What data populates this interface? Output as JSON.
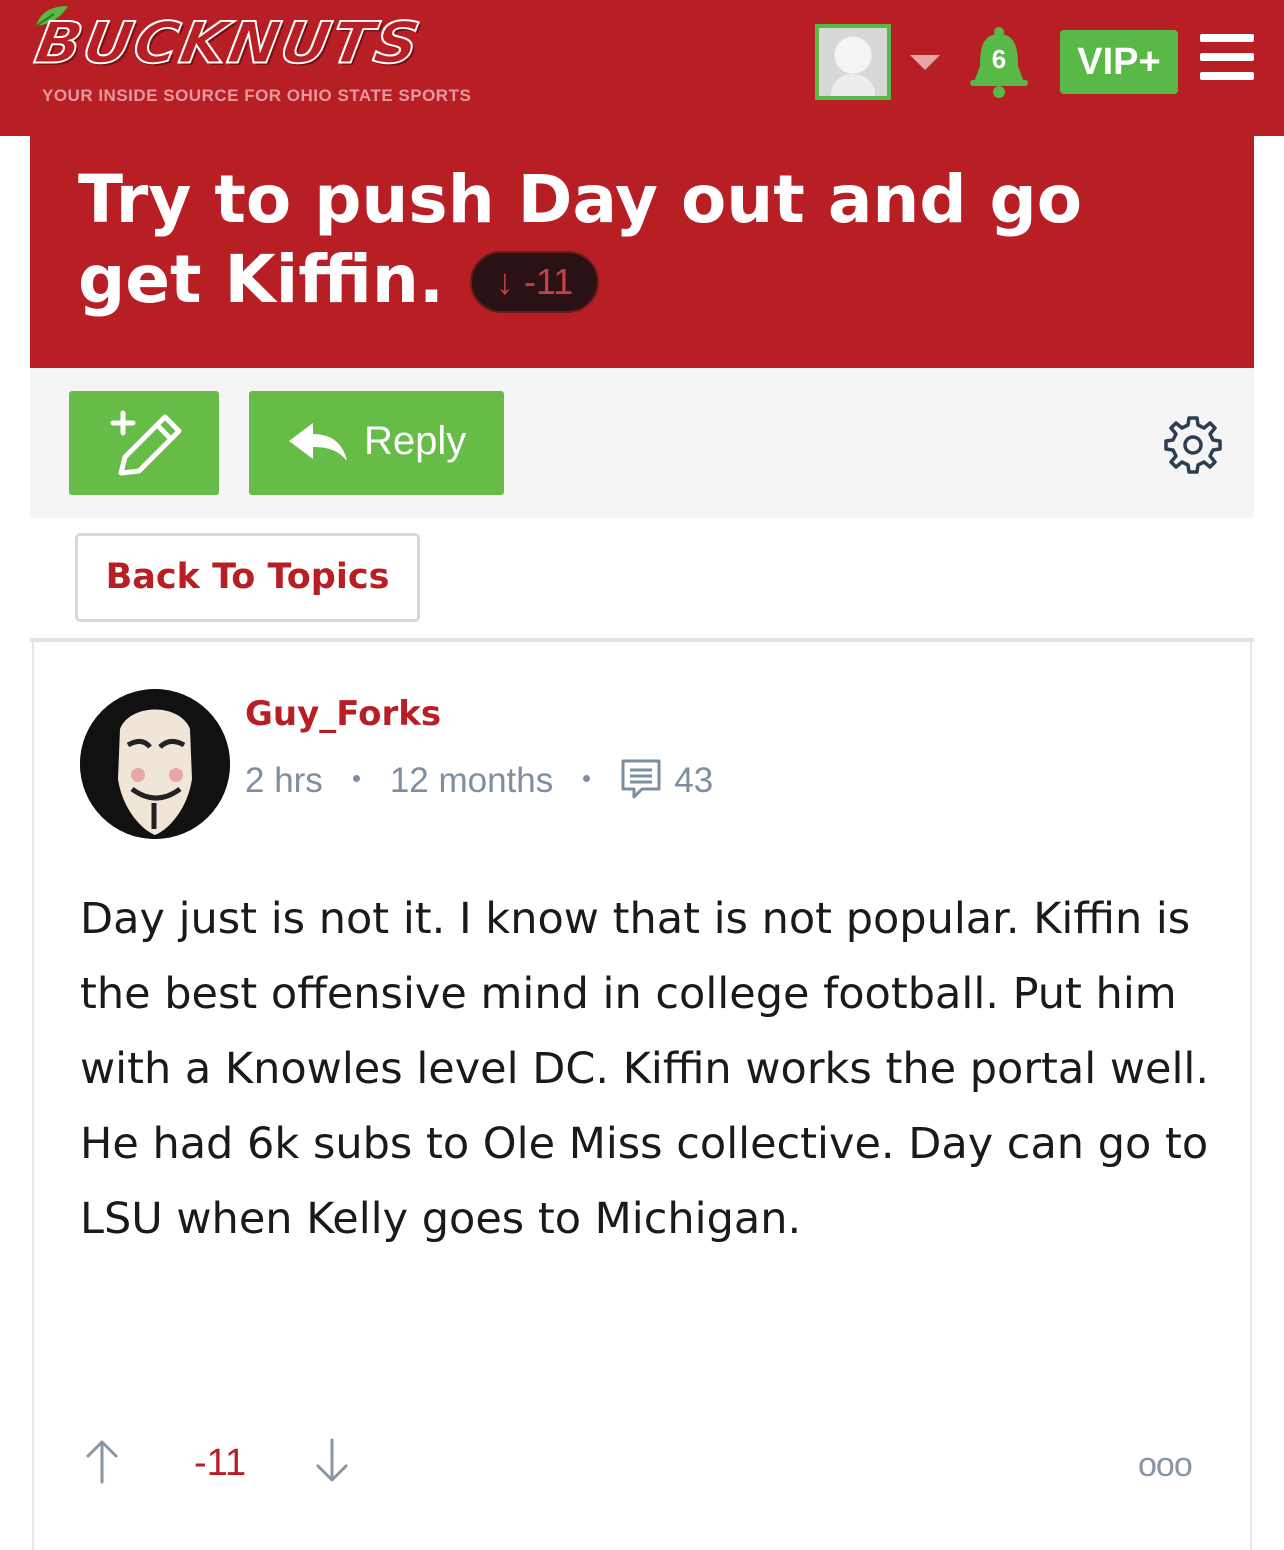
{
  "header": {
    "logo_text": "BUCKNUTS",
    "tagline": "YOUR INSIDE SOURCE FOR OHIO STATE SPORTS",
    "notification_count": "6",
    "vip_label": "VIP+",
    "brand_color": "#b81f25",
    "accent_color": "#58b947"
  },
  "topic": {
    "title": "Try to push Day out and go get Kiffin.",
    "score": "↓ -11"
  },
  "toolbar": {
    "new_topic_icon": "pencil-plus-icon",
    "reply_label": "Reply",
    "settings_icon": "gear-icon"
  },
  "nav": {
    "back_label": "Back To Topics"
  },
  "post": {
    "username": "Guy_Forks",
    "posted_ago": "2 hrs",
    "member_age": "12 months",
    "post_count": "43",
    "body": "Day just is not it. I know that is not popular. Kiffin is the best offensive mind in college football. Put him with a Knowles level DC. Kiffin works the portal well. He had 6k subs to Ole Miss collective. Day can go to LSU when Kelly goes to Michigan.",
    "vote_score": "-11",
    "more_label": "ooo"
  }
}
